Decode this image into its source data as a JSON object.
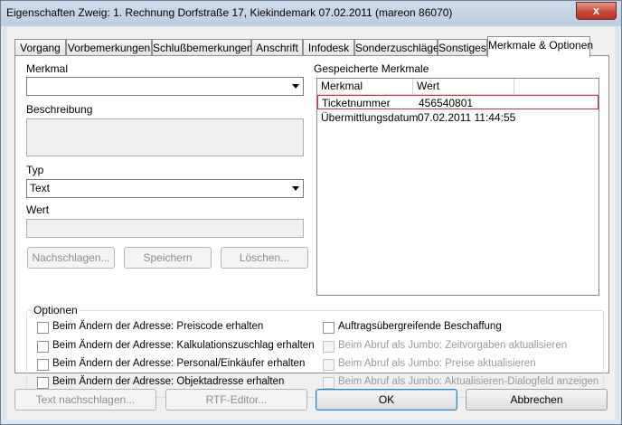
{
  "window": {
    "title": "Eigenschaften Zweig: 1. Rechnung Dorfstraße 17, Kiekindemark 07.02.2011 (mareon 86070)",
    "close_glyph": "x"
  },
  "tabs": [
    {
      "label": "Vorgang"
    },
    {
      "label": "Vorbemerkungen"
    },
    {
      "label": "Schlußbemerkungen"
    },
    {
      "label": "Anschrift"
    },
    {
      "label": "Infodesk"
    },
    {
      "label": "Sonderzuschläge"
    },
    {
      "label": "Sonstiges"
    },
    {
      "label": "Merkmale & Optionen",
      "active": true
    }
  ],
  "form": {
    "merkmal_label": "Merkmal",
    "merkmal_value": "",
    "beschreibung_label": "Beschreibung",
    "typ_label": "Typ",
    "typ_value": "Text",
    "wert_label": "Wert",
    "wert_value": "",
    "nachschlagen_button": "Nachschlagen...",
    "speichern_button": "Speichern",
    "loeschen_button": "Löschen..."
  },
  "saved": {
    "label": "Gespeicherte Merkmale",
    "columns": [
      "Merkmal",
      "Wert"
    ],
    "rows": [
      {
        "merkmal": "Ticketnummer",
        "wert": "456540801",
        "selected": true
      },
      {
        "merkmal": "Übermittlungsdatum",
        "wert": "07.02.2011 11:44:55"
      }
    ]
  },
  "options": {
    "legend": "Optionen",
    "left": [
      {
        "label": "Beim Ändern der Adresse: Preiscode erhalten",
        "checked": false,
        "enabled": true
      },
      {
        "label": "Beim Ändern der Adresse: Kalkulationszuschlag erhalten",
        "checked": false,
        "enabled": true
      },
      {
        "label": "Beim Ändern der Adresse: Personal/Einkäufer erhalten",
        "checked": false,
        "enabled": true
      },
      {
        "label": "Beim Ändern der Adresse: Objektadresse erhalten",
        "checked": false,
        "enabled": true
      }
    ],
    "right": [
      {
        "label": "Auftragsübergreifende Beschaffung",
        "checked": false,
        "enabled": true
      },
      {
        "label": "Beim Abruf als Jumbo: Zeitvorgaben aktualisieren",
        "checked": false,
        "enabled": false
      },
      {
        "label": "Beim Abruf als Jumbo: Preise aktualisieren",
        "checked": false,
        "enabled": false
      },
      {
        "label": "Beim Abruf als Jumbo: Aktualisieren-Dialogfeld anzeigen",
        "checked": false,
        "enabled": false
      }
    ]
  },
  "bottom": {
    "text_nachschlagen": "Text nachschlagen...",
    "rtf_editor": "RTF-Editor...",
    "ok": "OK",
    "abbrechen": "Abbrechen"
  }
}
